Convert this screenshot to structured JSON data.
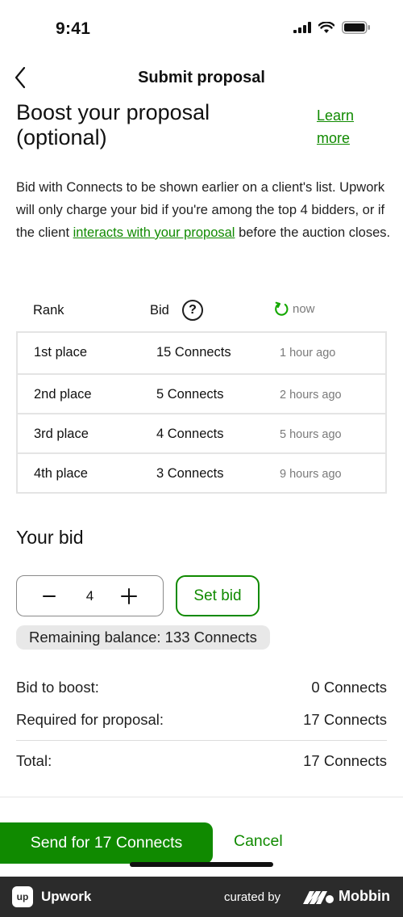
{
  "status_bar": {
    "time": "9:41"
  },
  "nav": {
    "title": "Submit proposal"
  },
  "boost": {
    "title": "Boost your proposal (optional)",
    "learn_more": "Learn more",
    "description_pre": "Bid with Connects to be shown earlier on a client's list. Upwork will only charge your bid if you're among the top 4 bidders, or if the client ",
    "description_link": "interacts with your proposal",
    "description_post": " before the auction closes."
  },
  "table": {
    "headers": {
      "rank": "Rank",
      "bid": "Bid",
      "help": "?",
      "refresh": "now"
    },
    "rows": [
      {
        "place": "1st place",
        "bid": "15 Connects",
        "time": "1 hour ago"
      },
      {
        "place": "2nd place",
        "bid": "5 Connects",
        "time": "2 hours ago"
      },
      {
        "place": "3rd place",
        "bid": "4 Connects",
        "time": "5 hours ago"
      },
      {
        "place": "4th place",
        "bid": "3 Connects",
        "time": "9 hours ago"
      }
    ]
  },
  "your_bid": {
    "title": "Your bid",
    "value": "4",
    "set_bid_label": "Set bid",
    "remaining_balance": "Remaining balance: 133 Connects"
  },
  "summary": {
    "bid_to_boost_label": "Bid to boost:",
    "bid_to_boost_value": "0 Connects",
    "required_label": "Required for proposal:",
    "required_value": "17 Connects",
    "total_label": "Total:",
    "total_value": "17 Connects"
  },
  "actions": {
    "send_label": "Send for 17 Connects",
    "cancel_label": "Cancel"
  },
  "footer": {
    "logo_text": "up",
    "app_name": "Upwork",
    "curated_by": "curated by",
    "brand": "Mobbin"
  },
  "colors": {
    "accent": "#108a00",
    "muted": "#7a7a7a",
    "footer_bg": "#2b2b2b"
  },
  "icons": {
    "back": "chevron-left-icon",
    "signal": "cellular-signal-icon",
    "wifi": "wifi-icon",
    "battery": "battery-icon",
    "refresh": "refresh-icon",
    "minus": "minus-icon",
    "plus": "plus-icon"
  }
}
